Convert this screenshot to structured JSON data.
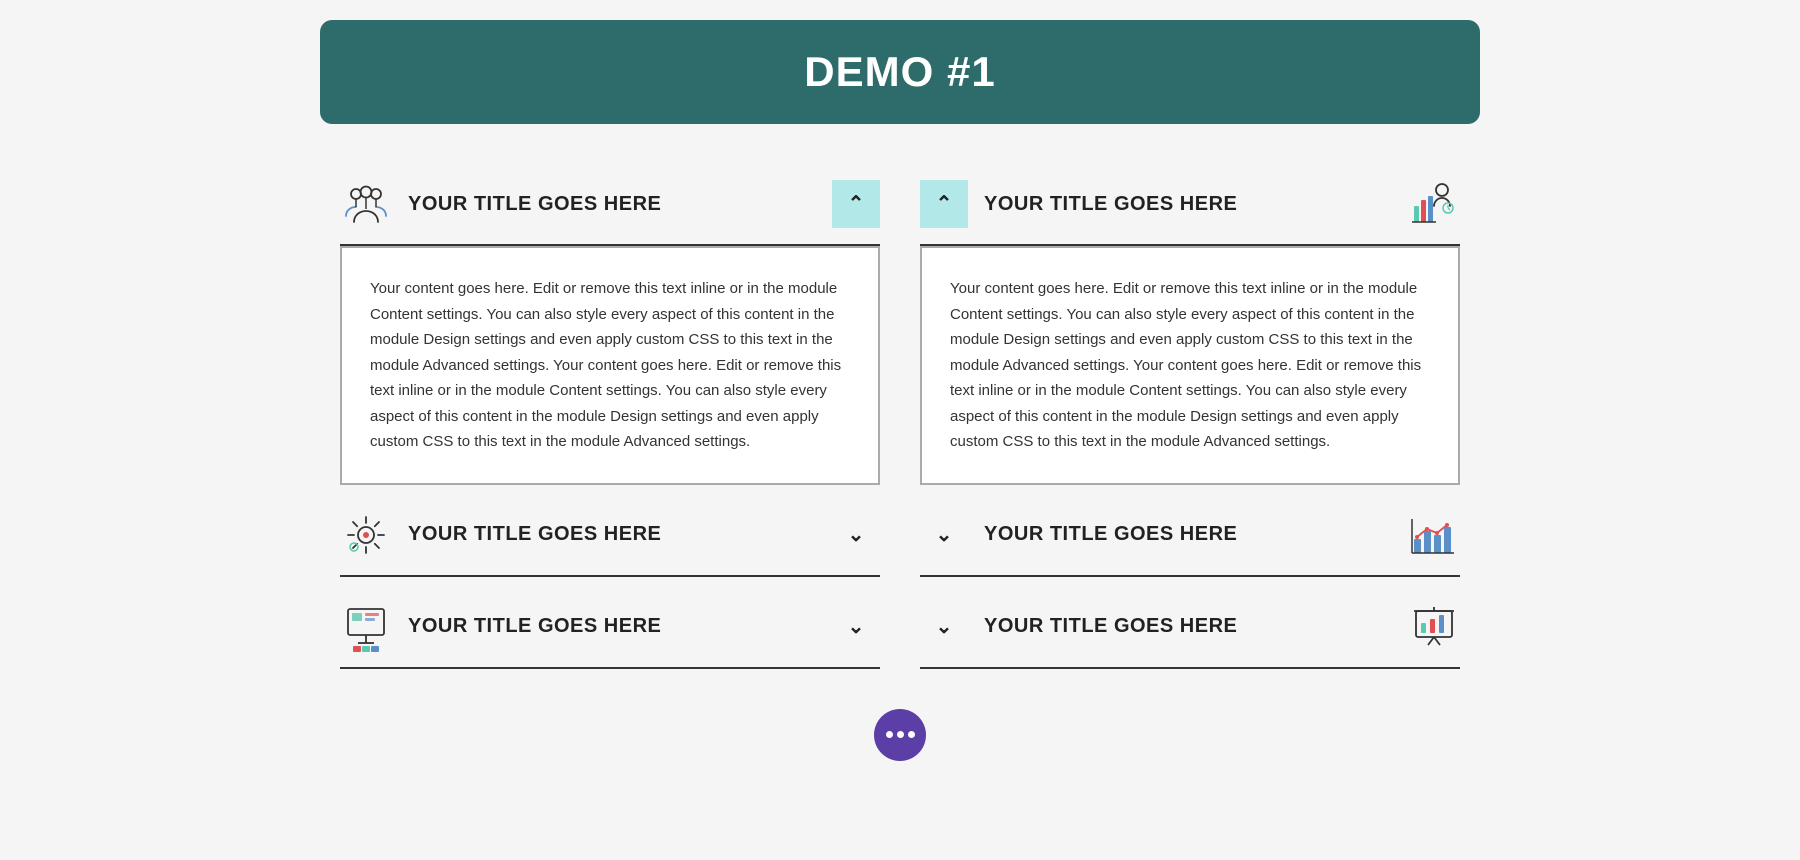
{
  "header": {
    "title": "DEMO #1",
    "bg_color": "#2e6b6b"
  },
  "left_column": {
    "items": [
      {
        "id": "left-1",
        "title": "YOUR TITLE GOES HERE",
        "icon": "people",
        "open": true,
        "content": "Your content goes here. Edit or remove this text inline or in the module Content settings. You can also style every aspect of this content in the module Design settings and even apply custom CSS to this text in the module Advanced settings. Your content goes here. Edit or remove this text inline or in the module Content settings. You can also style every aspect of this content in the module Design settings and even apply custom CSS to this text in the module Advanced settings."
      },
      {
        "id": "left-2",
        "title": "YOUR TITLE GOES HERE",
        "icon": "gear",
        "open": false,
        "content": ""
      },
      {
        "id": "left-3",
        "title": "YOUR TITLE GOES HERE",
        "icon": "monitor",
        "open": false,
        "content": ""
      }
    ]
  },
  "right_column": {
    "items": [
      {
        "id": "right-1",
        "title": "YOUR TITLE GOES HERE",
        "icon": "report",
        "open": true,
        "content": "Your content goes here. Edit or remove this text inline or in the module Content settings. You can also style every aspect of this content in the module Design settings and even apply custom CSS to this text in the module Advanced settings. Your content goes here. Edit or remove this text inline or in the module Content settings. You can also style every aspect of this content in the module Design settings and even apply custom CSS to this text in the module Advanced settings."
      },
      {
        "id": "right-2",
        "title": "YOUR TITLE GOES HERE",
        "icon": "chart-bar",
        "open": false,
        "content": ""
      },
      {
        "id": "right-3",
        "title": "YOUR TITLE GOES HERE",
        "icon": "presentation",
        "open": false,
        "content": ""
      }
    ]
  },
  "labels": {
    "chevron_up": "∧",
    "chevron_down": "∨"
  }
}
